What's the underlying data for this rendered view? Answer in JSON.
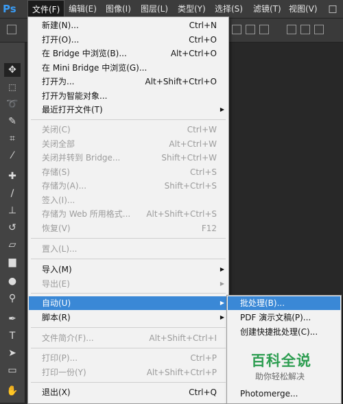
{
  "app": {
    "logo": "Ps"
  },
  "menubar": {
    "items": [
      "文件(F)",
      "编辑(E)",
      "图像(I)",
      "图层(L)",
      "类型(Y)",
      "选择(S)",
      "滤镜(T)",
      "视图(V)"
    ],
    "window_button": "□"
  },
  "file_menu": {
    "items": [
      {
        "label": "新建(N)...",
        "shortcut": "Ctrl+N",
        "enabled": true
      },
      {
        "label": "打开(O)...",
        "shortcut": "Ctrl+O",
        "enabled": true
      },
      {
        "label": "在 Bridge 中浏览(B)...",
        "shortcut": "Alt+Ctrl+O",
        "enabled": true
      },
      {
        "label": "在 Mini Bridge 中浏览(G)...",
        "shortcut": "",
        "enabled": true
      },
      {
        "label": "打开为...",
        "shortcut": "Alt+Shift+Ctrl+O",
        "enabled": true
      },
      {
        "label": "打开为智能对象...",
        "shortcut": "",
        "enabled": true
      },
      {
        "label": "最近打开文件(T)",
        "shortcut": "",
        "enabled": true,
        "submenu": true
      },
      {
        "label": "关闭(C)",
        "shortcut": "Ctrl+W",
        "enabled": false
      },
      {
        "label": "关闭全部",
        "shortcut": "Alt+Ctrl+W",
        "enabled": false
      },
      {
        "label": "关闭并转到 Bridge...",
        "shortcut": "Shift+Ctrl+W",
        "enabled": false
      },
      {
        "label": "存储(S)",
        "shortcut": "Ctrl+S",
        "enabled": false
      },
      {
        "label": "存储为(A)...",
        "shortcut": "Shift+Ctrl+S",
        "enabled": false
      },
      {
        "label": "签入(I)...",
        "shortcut": "",
        "enabled": false
      },
      {
        "label": "存储为 Web 所用格式...",
        "shortcut": "Alt+Shift+Ctrl+S",
        "enabled": false
      },
      {
        "label": "恢复(V)",
        "shortcut": "F12",
        "enabled": false
      },
      {
        "label": "置入(L)...",
        "shortcut": "",
        "enabled": false
      },
      {
        "label": "导入(M)",
        "shortcut": "",
        "enabled": true,
        "submenu": true
      },
      {
        "label": "导出(E)",
        "shortcut": "",
        "enabled": false,
        "submenu": true
      },
      {
        "label": "自动(U)",
        "shortcut": "",
        "enabled": true,
        "submenu": true,
        "highlighted": true
      },
      {
        "label": "脚本(R)",
        "shortcut": "",
        "enabled": true,
        "submenu": true
      },
      {
        "label": "文件简介(F)...",
        "shortcut": "Alt+Shift+Ctrl+I",
        "enabled": false
      },
      {
        "label": "打印(P)...",
        "shortcut": "Ctrl+P",
        "enabled": false
      },
      {
        "label": "打印一份(Y)",
        "shortcut": "Alt+Shift+Ctrl+P",
        "enabled": false
      },
      {
        "label": "退出(X)",
        "shortcut": "Ctrl+Q",
        "enabled": true
      }
    ]
  },
  "automate_submenu": {
    "items": [
      {
        "label": "批处理(B)...",
        "enabled": true,
        "highlighted": true
      },
      {
        "label": "PDF 演示文稿(P)...",
        "enabled": true
      },
      {
        "label": "创建快捷批处理(C)...",
        "enabled": true
      },
      {
        "label": "Photomerge...",
        "enabled": true
      }
    ]
  },
  "watermark": {
    "title": "百科全说",
    "subtitle": "助你轻松解决"
  },
  "colors": {
    "highlight": "#3a88d6",
    "menu_bg": "#f2f2f2",
    "chrome": "#3c3c3c",
    "logo": "#3a9cf5",
    "watermark": "#2c9d50"
  }
}
